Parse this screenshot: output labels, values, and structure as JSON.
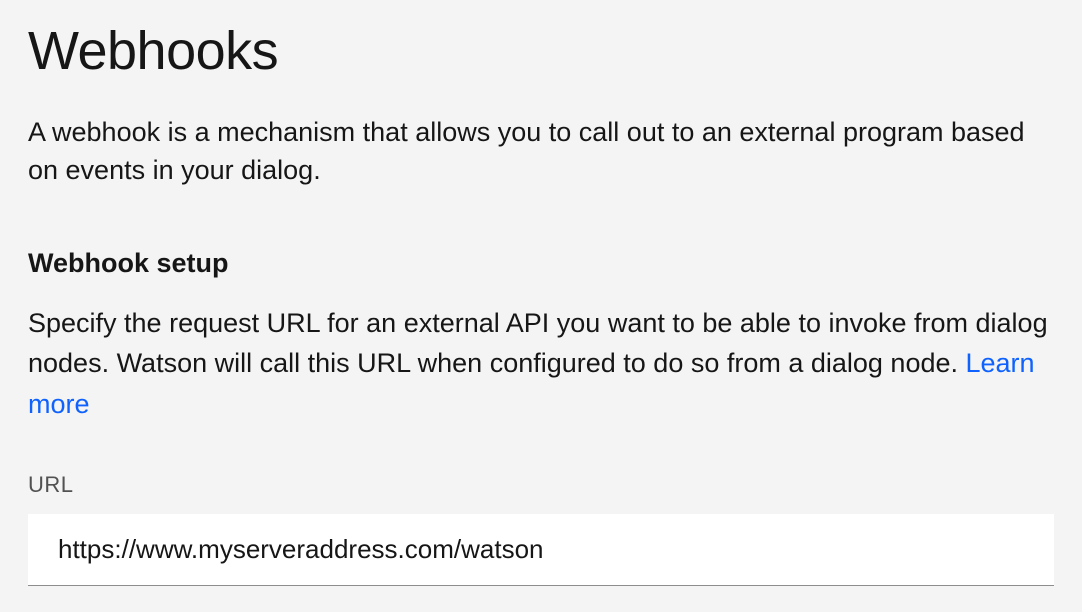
{
  "page": {
    "title": "Webhooks",
    "description": "A webhook is a mechanism that allows you to call out to an external program based on events in your dialog."
  },
  "setup": {
    "heading": "Webhook setup",
    "description_part1": "Specify the request URL for an external API you want to be able to invoke from dialog nodes. Watson will call this URL when configured to do so from a dialog node. ",
    "learn_more_label": "Learn more"
  },
  "url_field": {
    "label": "URL",
    "value": "https://www.myserveraddress.com/watson"
  }
}
